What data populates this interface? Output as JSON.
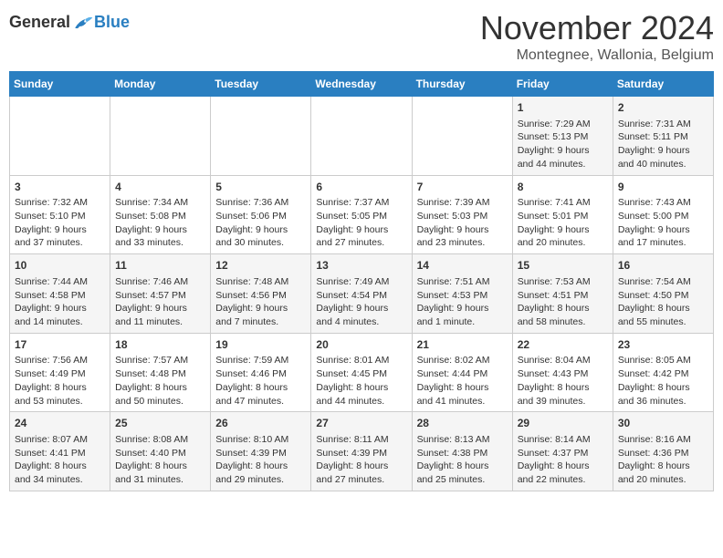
{
  "logo": {
    "general": "General",
    "blue": "Blue"
  },
  "title": "November 2024",
  "subtitle": "Montegnee, Wallonia, Belgium",
  "days_of_week": [
    "Sunday",
    "Monday",
    "Tuesday",
    "Wednesday",
    "Thursday",
    "Friday",
    "Saturday"
  ],
  "weeks": [
    [
      {
        "day": "",
        "info": ""
      },
      {
        "day": "",
        "info": ""
      },
      {
        "day": "",
        "info": ""
      },
      {
        "day": "",
        "info": ""
      },
      {
        "day": "",
        "info": ""
      },
      {
        "day": "1",
        "info": "Sunrise: 7:29 AM\nSunset: 5:13 PM\nDaylight: 9 hours and 44 minutes."
      },
      {
        "day": "2",
        "info": "Sunrise: 7:31 AM\nSunset: 5:11 PM\nDaylight: 9 hours and 40 minutes."
      }
    ],
    [
      {
        "day": "3",
        "info": "Sunrise: 7:32 AM\nSunset: 5:10 PM\nDaylight: 9 hours and 37 minutes."
      },
      {
        "day": "4",
        "info": "Sunrise: 7:34 AM\nSunset: 5:08 PM\nDaylight: 9 hours and 33 minutes."
      },
      {
        "day": "5",
        "info": "Sunrise: 7:36 AM\nSunset: 5:06 PM\nDaylight: 9 hours and 30 minutes."
      },
      {
        "day": "6",
        "info": "Sunrise: 7:37 AM\nSunset: 5:05 PM\nDaylight: 9 hours and 27 minutes."
      },
      {
        "day": "7",
        "info": "Sunrise: 7:39 AM\nSunset: 5:03 PM\nDaylight: 9 hours and 23 minutes."
      },
      {
        "day": "8",
        "info": "Sunrise: 7:41 AM\nSunset: 5:01 PM\nDaylight: 9 hours and 20 minutes."
      },
      {
        "day": "9",
        "info": "Sunrise: 7:43 AM\nSunset: 5:00 PM\nDaylight: 9 hours and 17 minutes."
      }
    ],
    [
      {
        "day": "10",
        "info": "Sunrise: 7:44 AM\nSunset: 4:58 PM\nDaylight: 9 hours and 14 minutes."
      },
      {
        "day": "11",
        "info": "Sunrise: 7:46 AM\nSunset: 4:57 PM\nDaylight: 9 hours and 11 minutes."
      },
      {
        "day": "12",
        "info": "Sunrise: 7:48 AM\nSunset: 4:56 PM\nDaylight: 9 hours and 7 minutes."
      },
      {
        "day": "13",
        "info": "Sunrise: 7:49 AM\nSunset: 4:54 PM\nDaylight: 9 hours and 4 minutes."
      },
      {
        "day": "14",
        "info": "Sunrise: 7:51 AM\nSunset: 4:53 PM\nDaylight: 9 hours and 1 minute."
      },
      {
        "day": "15",
        "info": "Sunrise: 7:53 AM\nSunset: 4:51 PM\nDaylight: 8 hours and 58 minutes."
      },
      {
        "day": "16",
        "info": "Sunrise: 7:54 AM\nSunset: 4:50 PM\nDaylight: 8 hours and 55 minutes."
      }
    ],
    [
      {
        "day": "17",
        "info": "Sunrise: 7:56 AM\nSunset: 4:49 PM\nDaylight: 8 hours and 53 minutes."
      },
      {
        "day": "18",
        "info": "Sunrise: 7:57 AM\nSunset: 4:48 PM\nDaylight: 8 hours and 50 minutes."
      },
      {
        "day": "19",
        "info": "Sunrise: 7:59 AM\nSunset: 4:46 PM\nDaylight: 8 hours and 47 minutes."
      },
      {
        "day": "20",
        "info": "Sunrise: 8:01 AM\nSunset: 4:45 PM\nDaylight: 8 hours and 44 minutes."
      },
      {
        "day": "21",
        "info": "Sunrise: 8:02 AM\nSunset: 4:44 PM\nDaylight: 8 hours and 41 minutes."
      },
      {
        "day": "22",
        "info": "Sunrise: 8:04 AM\nSunset: 4:43 PM\nDaylight: 8 hours and 39 minutes."
      },
      {
        "day": "23",
        "info": "Sunrise: 8:05 AM\nSunset: 4:42 PM\nDaylight: 8 hours and 36 minutes."
      }
    ],
    [
      {
        "day": "24",
        "info": "Sunrise: 8:07 AM\nSunset: 4:41 PM\nDaylight: 8 hours and 34 minutes."
      },
      {
        "day": "25",
        "info": "Sunrise: 8:08 AM\nSunset: 4:40 PM\nDaylight: 8 hours and 31 minutes."
      },
      {
        "day": "26",
        "info": "Sunrise: 8:10 AM\nSunset: 4:39 PM\nDaylight: 8 hours and 29 minutes."
      },
      {
        "day": "27",
        "info": "Sunrise: 8:11 AM\nSunset: 4:39 PM\nDaylight: 8 hours and 27 minutes."
      },
      {
        "day": "28",
        "info": "Sunrise: 8:13 AM\nSunset: 4:38 PM\nDaylight: 8 hours and 25 minutes."
      },
      {
        "day": "29",
        "info": "Sunrise: 8:14 AM\nSunset: 4:37 PM\nDaylight: 8 hours and 22 minutes."
      },
      {
        "day": "30",
        "info": "Sunrise: 8:16 AM\nSunset: 4:36 PM\nDaylight: 8 hours and 20 minutes."
      }
    ]
  ]
}
